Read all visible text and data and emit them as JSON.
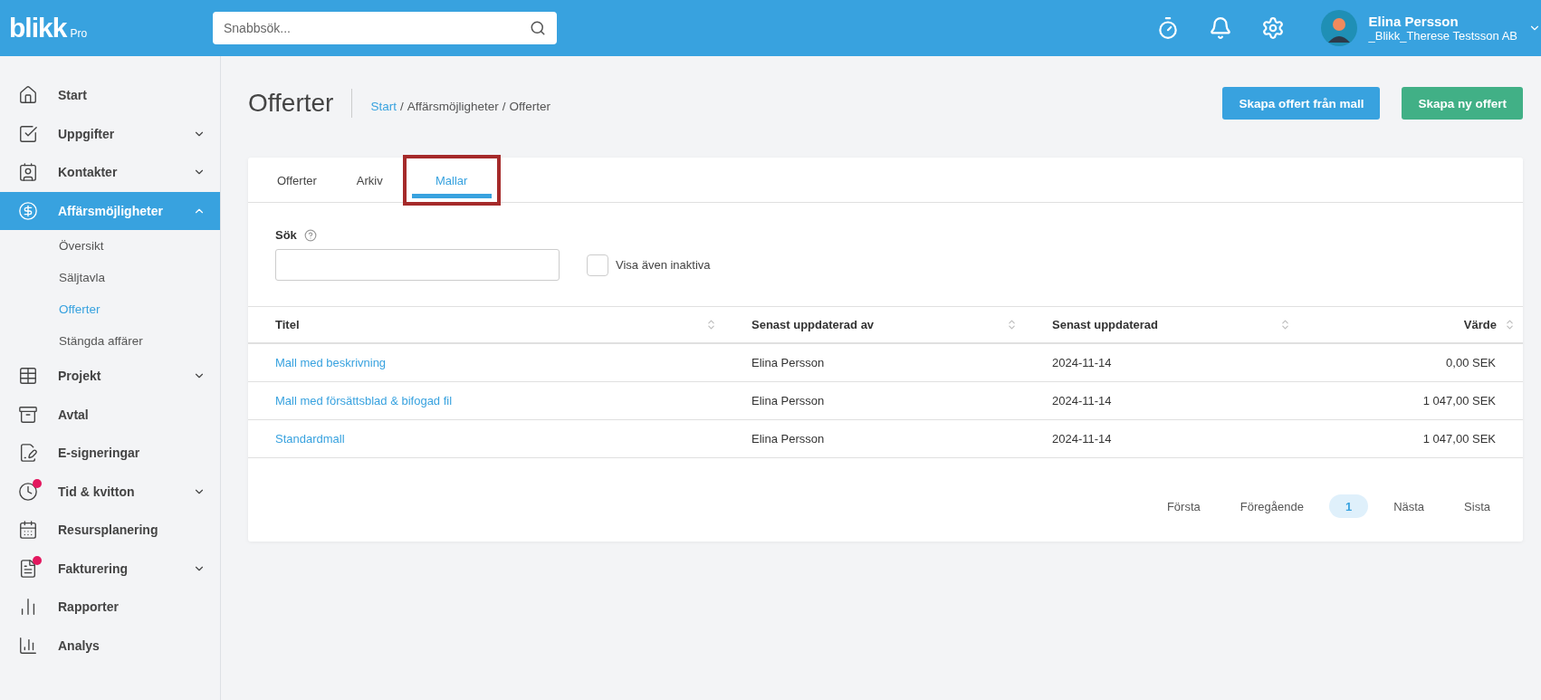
{
  "header": {
    "logo": "blikk",
    "logo_suffix": "Pro",
    "search": {
      "placeholder": "Snabbsök..."
    },
    "user": {
      "name": "Elina Persson",
      "company": "_Blikk_Therese Testsson AB"
    }
  },
  "sidebar": {
    "items": [
      {
        "label": "Start",
        "expandable": false,
        "selected": false,
        "notification": false
      },
      {
        "label": "Uppgifter",
        "expandable": true,
        "expanded": false,
        "selected": false,
        "notification": false
      },
      {
        "label": "Kontakter",
        "expandable": true,
        "expanded": false,
        "selected": false,
        "notification": false
      },
      {
        "label": "Affärsmöjligheter",
        "expandable": true,
        "expanded": true,
        "selected": true,
        "notification": false,
        "children": [
          {
            "label": "Översikt",
            "selected": false
          },
          {
            "label": "Säljtavla",
            "selected": false
          },
          {
            "label": "Offerter",
            "selected": true
          },
          {
            "label": "Stängda affärer",
            "selected": false
          }
        ]
      },
      {
        "label": "Projekt",
        "expandable": true,
        "expanded": false,
        "selected": false,
        "notification": false
      },
      {
        "label": "Avtal",
        "expandable": false,
        "selected": false,
        "notification": false
      },
      {
        "label": "E-signeringar",
        "expandable": false,
        "selected": false,
        "notification": false
      },
      {
        "label": "Tid & kvitton",
        "expandable": true,
        "expanded": false,
        "selected": false,
        "notification": true
      },
      {
        "label": "Resursplanering",
        "expandable": false,
        "selected": false,
        "notification": false
      },
      {
        "label": "Fakturering",
        "expandable": true,
        "expanded": false,
        "selected": false,
        "notification": true
      },
      {
        "label": "Rapporter",
        "expandable": false,
        "selected": false,
        "notification": false
      },
      {
        "label": "Analys",
        "expandable": false,
        "selected": false,
        "notification": false
      }
    ]
  },
  "page": {
    "title": "Offerter",
    "breadcrumb": [
      {
        "label": "Start",
        "link": true
      },
      {
        "label": "Affärsmöjligheter",
        "link": false
      },
      {
        "label": "Offerter",
        "link": false
      }
    ],
    "separator": "/",
    "buttons": [
      {
        "label": "Skapa offert från mall",
        "kind": "primary"
      },
      {
        "label": "Skapa ny offert",
        "kind": "success"
      }
    ]
  },
  "tabs": [
    {
      "label": "Offerter",
      "selected": false,
      "highlighted": false
    },
    {
      "label": "Arkiv",
      "selected": false,
      "highlighted": false
    },
    {
      "label": "Mallar",
      "selected": true,
      "highlighted": true
    }
  ],
  "filters": {
    "search_label": "Sök",
    "checkbox": {
      "label": "Visa även inaktiva",
      "checked": false
    }
  },
  "table": {
    "columns": [
      {
        "label": "Titel"
      },
      {
        "label": "Senast uppdaterad av"
      },
      {
        "label": "Senast uppdaterad"
      },
      {
        "label": "Värde"
      }
    ],
    "rows": [
      [
        "Mall med beskrivning",
        "Elina Persson",
        "2024-11-14",
        "0,00 SEK"
      ],
      [
        "Mall med försättsblad & bifogad fil",
        "Elina Persson",
        "2024-11-14",
        "1 047,00 SEK"
      ],
      [
        "Standardmall",
        "Elina Persson",
        "2024-11-14",
        "1 047,00 SEK"
      ]
    ]
  },
  "pagination": [
    {
      "label": "Första",
      "selected": false
    },
    {
      "label": "Föregående",
      "selected": false
    },
    {
      "label": "1",
      "selected": true
    },
    {
      "label": "Nästa",
      "selected": false
    },
    {
      "label": "Sista",
      "selected": false
    }
  ]
}
